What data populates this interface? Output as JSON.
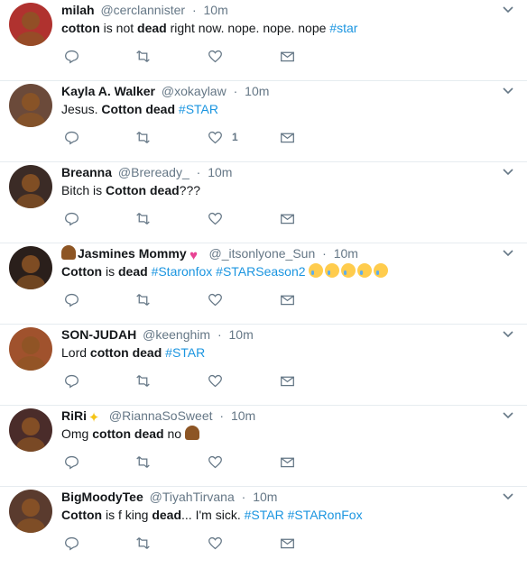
{
  "tweets": [
    {
      "name": "milah",
      "handle": "@cerclannister",
      "time": "10m",
      "avatar_color": "#b0322f",
      "text_parts": [
        {
          "t": "cotton",
          "b": true
        },
        {
          "t": " is not "
        },
        {
          "t": "dead",
          "b": true
        },
        {
          "t": " right now. nope. nope. nope "
        },
        {
          "t": "#star",
          "tag": true
        }
      ],
      "likes": ""
    },
    {
      "name": "Kayla A. Walker",
      "handle": "@xokaylaw",
      "time": "10m",
      "avatar_color": "#6b4a3a",
      "text_parts": [
        {
          "t": "Jesus. "
        },
        {
          "t": "Cotton dead",
          "b": true
        },
        {
          "t": " "
        },
        {
          "t": "#STAR",
          "tag": true
        }
      ],
      "likes": "1"
    },
    {
      "name": "Breanna",
      "handle": "@Breready_",
      "time": "10m",
      "avatar_color": "#3b2b26",
      "text_parts": [
        {
          "t": "Bitch is "
        },
        {
          "t": "Cotton dead",
          "b": true
        },
        {
          "t": "???"
        }
      ],
      "likes": ""
    },
    {
      "name": "Jasmines Mommy",
      "name_prefix_emoji": "person-icon",
      "name_suffix_emoji": "heart-icon",
      "handle": "@_itsonlyone_Sun",
      "time": "10m",
      "avatar_color": "#2a1f1b",
      "text_parts": [
        {
          "t": "Cotton",
          "b": true
        },
        {
          "t": " is "
        },
        {
          "t": "dead",
          "b": true
        },
        {
          "t": " "
        },
        {
          "t": "#Staronfox",
          "tag": true
        },
        {
          "t": " "
        },
        {
          "t": "#STARSeason2",
          "tag": true
        },
        {
          "t": " "
        }
      ],
      "trailing_emojis": [
        "crying-face-icon",
        "crying-face-icon",
        "crying-face-icon",
        "crying-face-icon",
        "crying-face-icon"
      ],
      "likes": ""
    },
    {
      "name": "SON-JUDAH",
      "handle": "@keenghim",
      "time": "10m",
      "avatar_color": "#a0522d",
      "text_parts": [
        {
          "t": "Lord "
        },
        {
          "t": "cotton dead",
          "b": true
        },
        {
          "t": "  "
        },
        {
          "t": "#STAR",
          "tag": true
        }
      ],
      "likes": ""
    },
    {
      "name": "RiRi",
      "name_suffix_emoji": "sparkles-icon",
      "handle": "@RiannaSoSweet",
      "time": "10m",
      "avatar_color": "#4a2c2a",
      "text_parts": [
        {
          "t": "Omg "
        },
        {
          "t": "cotton dead",
          "b": true
        },
        {
          "t": " no "
        }
      ],
      "trailing_emojis": [
        "person-facepalming-icon"
      ],
      "likes": ""
    },
    {
      "name": "BigMoodyTee",
      "handle": "@TiyahTirvana",
      "time": "10m",
      "avatar_color": "#5a3b2e",
      "text_parts": [
        {
          "t": "Cotton",
          "b": true
        },
        {
          "t": " is f    king "
        },
        {
          "t": "dead",
          "b": true
        },
        {
          "t": "... I'm sick. "
        },
        {
          "t": "#STAR",
          "tag": true
        },
        {
          "t": " "
        },
        {
          "t": "#STARonFox",
          "tag": true
        }
      ],
      "likes": ""
    }
  ],
  "colors": {
    "link": "#1b95e0",
    "muted": "#657786",
    "divider": "#e6ecf0"
  },
  "icons": {
    "reply": "reply-icon",
    "retweet": "retweet-icon",
    "like": "heart-outline-icon",
    "dm": "envelope-icon",
    "menu": "chevron-down-icon"
  }
}
